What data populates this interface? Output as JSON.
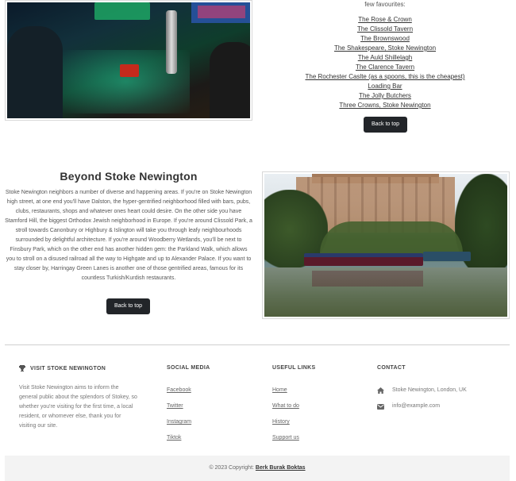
{
  "favourites": {
    "intro": "few favourites:",
    "pubs": [
      "The Rose & Crown",
      "The Clissold Tavern",
      "The Brownswood",
      "The Shakespeare, Stoke Newington",
      "The Auld Shillelagh",
      "The Clarence Tavern",
      "The Rochester Caslte (as a spoons, this is the cheapest)",
      "Loading Bar",
      "The Jolly Butchers",
      "Three Crowns, Stoke Newington"
    ],
    "back_to_top": "Back to top"
  },
  "beyond": {
    "title": "Beyond Stoke Newington",
    "body": "Stoke Newington neighbors a number of diverse and happening areas. If you're on Stoke Newington high street, at one end you'll have Dalston, the hyper-gentrified neighborhood filled with bars, pubs, clubs, restaurants, shops and whatever ones heart could desire. On the other side you have Stamford Hill, the biggest Orthodox Jewish neighborhood in Europe. If you're around Clissold Park, a stroll towards Canonbury or Highbury & Islington will take you through leafy neighbourhoods surrounded by delightful architecture. If you're around Woodberry Wetlands, you'll be next to Finsbury Park, which on the other end has another hidden gem: the Parkland Walk, which allows you to stroll on a disused railroad all the way to Highgate and up to Alexander Palace. If you want to stay closer by, Harringay Green Lanes is another one of those gentrified areas, famous for its countless Turkish/Kurdish restaurants.",
    "back_to_top": "Back to top"
  },
  "footer": {
    "about": {
      "heading": "VISIT STOKE NEWINGTON",
      "icon": "trophy-icon",
      "text": "Visit Stoke Newington aims to inform the general public about the splendors of Stokey, so whether you're visiting for the first time, a local resident, or whomever else, thank you for visiting our site."
    },
    "social": {
      "heading": "SOCIAL MEDIA",
      "links": [
        "Facebook",
        "Twitter",
        "Instagram",
        "Tiktok"
      ]
    },
    "useful": {
      "heading": "USEFUL LINKS",
      "links": [
        "Home",
        "What to do",
        "History",
        "Support us"
      ]
    },
    "contact": {
      "heading": "CONTACT",
      "address": "Stoke Newington, London, UK",
      "email": "info@example.com"
    },
    "copyright_prefix": "© 2023 Copyright:",
    "copyright_name": "Berk Burak Boktas"
  },
  "colors": {
    "button_bg": "#222529",
    "divider": "#cfcfcf",
    "copyright_bg": "#f3f3f3"
  }
}
